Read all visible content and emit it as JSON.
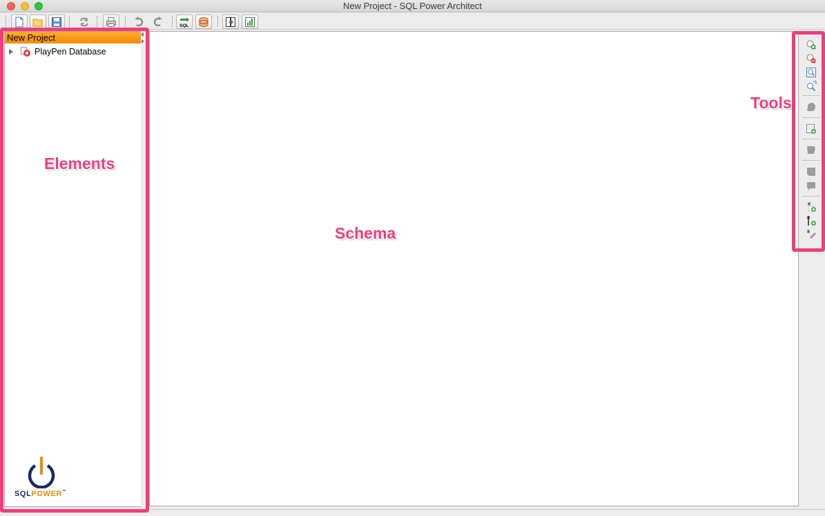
{
  "window": {
    "title": "New Project - SQL Power Architect"
  },
  "toolbar": {
    "buttons": [
      {
        "name": "new-project-icon"
      },
      {
        "name": "open-project-icon"
      },
      {
        "name": "save-project-icon"
      },
      {
        "name": "refresh-icon"
      },
      {
        "name": "print-icon"
      },
      {
        "name": "undo-icon"
      },
      {
        "name": "redo-icon"
      },
      {
        "name": "forward-engineer-sql-icon"
      },
      {
        "name": "compare-dm-icon"
      },
      {
        "name": "data-mover-icon"
      },
      {
        "name": "profile-icon"
      }
    ]
  },
  "tree": {
    "project_name": "New Project",
    "items": [
      {
        "label": "PlayPen Database",
        "icon": "playpen-database-icon"
      }
    ]
  },
  "logo": {
    "text_main": "SQL",
    "text_accent": "POWER",
    "trademark": "™"
  },
  "tools": {
    "buttons": [
      "zoom-in-icon",
      "zoom-out-icon",
      "zoom-normal-icon",
      "zoom-to-fit-icon",
      "auto-layout-icon",
      "create-table-icon",
      "insert-index-icon",
      "create-identifying-relationship-icon",
      "create-non-identifying-relationship-icon",
      "insert-column-icon",
      "insert-column-at-icon",
      "edit-column-icon"
    ]
  },
  "annotations": {
    "elements_label": "Elements",
    "schema_label": "Schema",
    "tools_label": "Tools",
    "highlight_color": "#f23c7b"
  },
  "colors": {
    "project_header": "#f08b00",
    "logo_blue": "#1d2a6b",
    "logo_orange": "#f08b00"
  }
}
